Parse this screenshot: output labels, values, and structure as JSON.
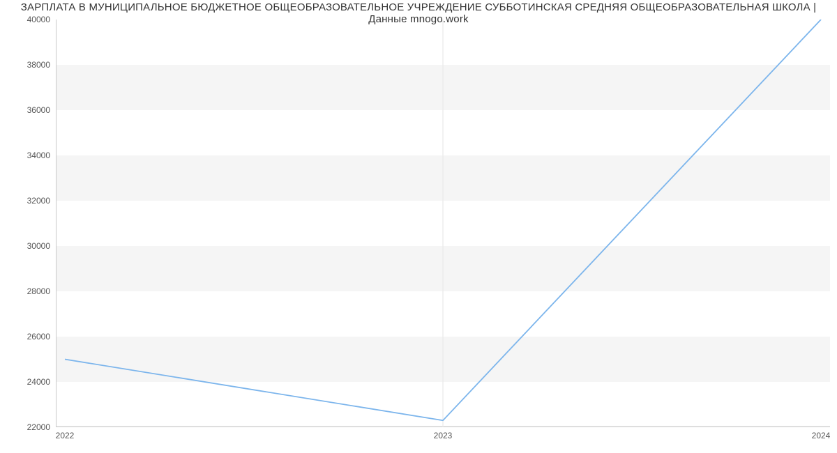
{
  "chart_data": {
    "type": "line",
    "title": "ЗАРПЛАТА В МУНИЦИПАЛЬНОЕ БЮДЖЕТНОЕ ОБЩЕОБРАЗОВАТЕЛЬНОЕ УЧРЕЖДЕНИЕ СУББОТИНСКАЯ СРЕДНЯЯ ОБЩЕОБРАЗОВАТЕЛЬНАЯ ШКОЛА | Данные mnogo.work",
    "x": [
      2022,
      2023,
      2024
    ],
    "x_labels": [
      "2022",
      "2023",
      "2024"
    ],
    "values": [
      25000,
      22300,
      40000
    ],
    "y_ticks": [
      22000,
      24000,
      26000,
      28000,
      30000,
      32000,
      34000,
      36000,
      38000,
      40000
    ],
    "y_tick_labels": [
      "22000",
      "24000",
      "26000",
      "28000",
      "30000",
      "32000",
      "34000",
      "36000",
      "38000",
      "40000"
    ],
    "ylim": [
      22000,
      40000
    ],
    "xlim": [
      2022,
      2024
    ],
    "line_color": "#7cb5ec"
  }
}
